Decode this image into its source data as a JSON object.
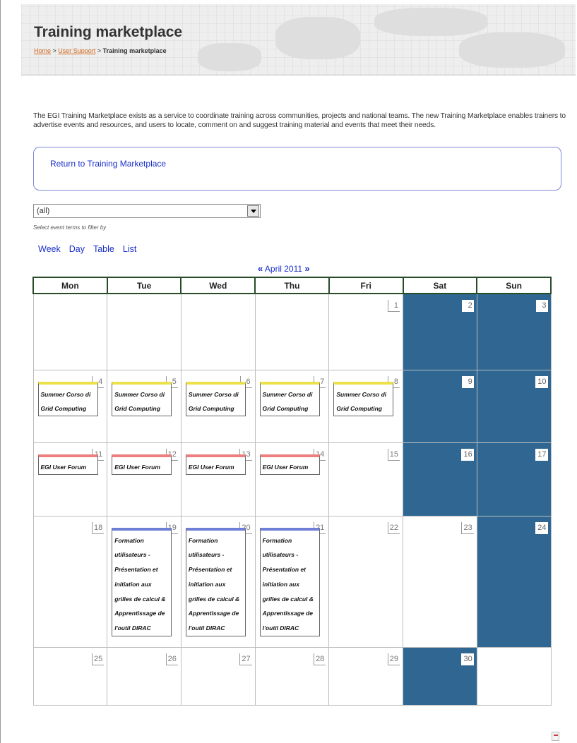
{
  "header": {
    "title": "Training marketplace",
    "breadcrumb": {
      "home": "Home",
      "sep1": " > ",
      "user_support": "User Support",
      "sep2": " > ",
      "current": "Training marketplace"
    }
  },
  "intro_text": "The EGI Training Marketplace exists as a service to coordinate training across communities, projects and national teams. The new Training Marketplace enables trainers to advertise events and resources, and users to locate, comment on and suggest training material and events that meet their needs.",
  "return_link": "Return to Training Marketplace",
  "filter": {
    "selected": "(all)",
    "help": "Select event terms to filter by"
  },
  "views": [
    "Week",
    "Day",
    "Table",
    "List"
  ],
  "month_nav": {
    "prev": "«",
    "label": "April 2011",
    "next": "»"
  },
  "weekdays": [
    "Mon",
    "Tue",
    "Wed",
    "Thu",
    "Fri",
    "Sat",
    "Sun"
  ],
  "colors": {
    "weekend_shade": "#2f6792",
    "header_border": "#274d27",
    "link": "#1a2fc8",
    "breadcrumb_link": "#d2691e"
  },
  "weeks": [
    [
      {
        "day": ""
      },
      {
        "day": ""
      },
      {
        "day": ""
      },
      {
        "day": ""
      },
      {
        "day": "1"
      },
      {
        "day": "2",
        "shaded": true
      },
      {
        "day": "3",
        "shaded": true
      }
    ],
    [
      {
        "day": "4",
        "event": "Summer Corso di Grid Computing",
        "event_color": "yellow"
      },
      {
        "day": "5",
        "event": "Summer Corso di Grid Computing",
        "event_color": "yellow"
      },
      {
        "day": "6",
        "event": "Summer Corso di Grid Computing",
        "event_color": "yellow"
      },
      {
        "day": "7",
        "event": "Summer Corso di Grid Computing",
        "event_color": "yellow"
      },
      {
        "day": "8",
        "event": "Summer Corso di Grid Computing",
        "event_color": "yellow"
      },
      {
        "day": "9",
        "shaded": true
      },
      {
        "day": "10",
        "shaded": true
      }
    ],
    [
      {
        "day": "11",
        "event": "EGI User Forum",
        "event_color": "red"
      },
      {
        "day": "12",
        "event": "EGI User Forum",
        "event_color": "red"
      },
      {
        "day": "13",
        "event": "EGI User Forum",
        "event_color": "red"
      },
      {
        "day": "14",
        "event": "EGI User Forum",
        "event_color": "red"
      },
      {
        "day": "15"
      },
      {
        "day": "16",
        "shaded": true
      },
      {
        "day": "17",
        "shaded": true
      }
    ],
    [
      {
        "day": "18"
      },
      {
        "day": "19",
        "event": "Formation utilisateurs - Présentation et initiation aux grilles de calcul & Apprentissage de l'outil DIRAC",
        "event_color": "blue"
      },
      {
        "day": "20",
        "event": "Formation utilisateurs - Présentation et initiation aux grilles de calcul & Apprentissage de l'outil DIRAC",
        "event_color": "blue"
      },
      {
        "day": "21",
        "event": "Formation utilisateurs - Présentation et initiation aux grilles de calcul & Apprentissage de l'outil DIRAC",
        "event_color": "blue"
      },
      {
        "day": "22"
      },
      {
        "day": "23"
      },
      {
        "day": "24",
        "shaded": true
      }
    ],
    [
      {
        "day": "25"
      },
      {
        "day": "26"
      },
      {
        "day": "27"
      },
      {
        "day": "28"
      },
      {
        "day": "29"
      },
      {
        "day": "30",
        "shaded": true
      },
      {
        "day": "",
        "blank": true
      }
    ]
  ],
  "footer_icon": "ical-feed-icon"
}
